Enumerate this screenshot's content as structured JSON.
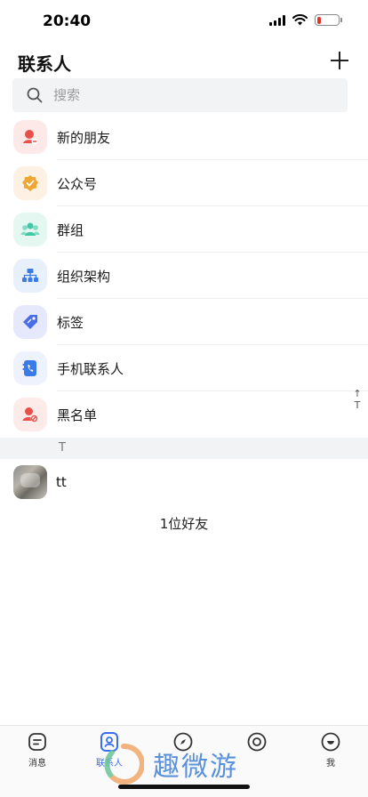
{
  "status_bar": {
    "time": "20:40",
    "battery_level": 0.2
  },
  "header": {
    "title": "联系人"
  },
  "search": {
    "placeholder": "搜索"
  },
  "menu": [
    {
      "label": "新的朋友",
      "icon": "new-friend-icon",
      "color": "#e8504a",
      "bg": "#fde9e8"
    },
    {
      "label": "公众号",
      "icon": "official-account-icon",
      "color": "#f0a632",
      "bg": "#fdf1e3"
    },
    {
      "label": "群组",
      "icon": "group-icon",
      "color": "#40c7a4",
      "bg": "#e4f7f1"
    },
    {
      "label": "组织架构",
      "icon": "org-chart-icon",
      "color": "#3a7be8",
      "bg": "#e8f0fc"
    },
    {
      "label": "标签",
      "icon": "tag-icon",
      "color": "#4a6ee8",
      "bg": "#e5e9fb"
    },
    {
      "label": "手机联系人",
      "icon": "phone-contacts-icon",
      "color": "#3a7be8",
      "bg": "#edf2fc"
    },
    {
      "label": "黑名单",
      "icon": "blacklist-icon",
      "color": "#e8504a",
      "bg": "#fdebea"
    }
  ],
  "index_bar": {
    "up": "↑",
    "letter": "T"
  },
  "section": {
    "letter": "T"
  },
  "contacts": [
    {
      "name": "tt"
    }
  ],
  "friend_count": "1位好友",
  "tabs": [
    {
      "label": "消息",
      "icon": "message-icon",
      "active": false
    },
    {
      "label": "联系人",
      "icon": "contacts-icon",
      "active": true
    },
    {
      "label": "",
      "icon": "compass-icon",
      "active": false
    },
    {
      "label": "",
      "icon": "circle-icon",
      "active": false
    },
    {
      "label": "我",
      "icon": "me-icon",
      "active": false
    }
  ],
  "watermark": "趣微游",
  "colors": {
    "accent": "#3a6df0",
    "battery_low": "#e5322d"
  }
}
